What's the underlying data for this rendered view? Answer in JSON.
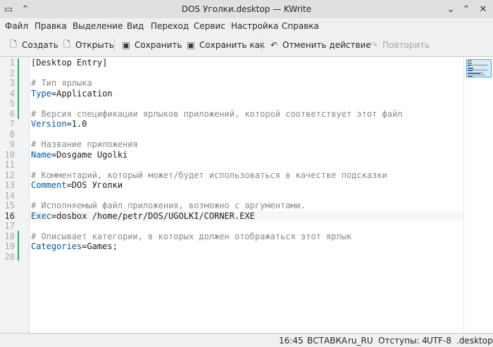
{
  "window": {
    "title": "DOS Уголки.desktop — KWrite"
  },
  "menu": [
    "Файл",
    "Правка",
    "Выделение",
    "Вид",
    "Переход",
    "Сервис",
    "Настройка",
    "Справка"
  ],
  "toolbar": {
    "new_label": "Создать",
    "open_label": "Открыть",
    "save_label": "Сохранить",
    "save_as_label": "Сохранить как",
    "undo_label": "Отменить действие",
    "redo_label": "Повторить"
  },
  "editor": {
    "current_line": 16,
    "lines": [
      [
        {
          "t": "[Desktop Entry]",
          "c": "plain"
        }
      ],
      [],
      [
        {
          "t": "# Тип ярлыка",
          "c": "comment"
        }
      ],
      [
        {
          "t": "Type",
          "c": "key"
        },
        {
          "t": "=Application",
          "c": "plain"
        }
      ],
      [],
      [
        {
          "t": "# Версия спецификации ярлыков приложений, которой соответствует этот файл",
          "c": "comment"
        }
      ],
      [
        {
          "t": "Version",
          "c": "key"
        },
        {
          "t": "=1.0",
          "c": "plain"
        }
      ],
      [],
      [
        {
          "t": "# Название приложения",
          "c": "comment"
        }
      ],
      [
        {
          "t": "Name",
          "c": "key"
        },
        {
          "t": "=Dosgame Ugolki",
          "c": "plain"
        }
      ],
      [],
      [
        {
          "t": "# Комментарий, который может/будет использоваться в качестве подсказки",
          "c": "comment"
        }
      ],
      [
        {
          "t": "Comment",
          "c": "key"
        },
        {
          "t": "=DOS Уголки",
          "c": "plain"
        }
      ],
      [],
      [
        {
          "t": "# Исполняемый файл приложения, возможно с аргументами.",
          "c": "comment"
        }
      ],
      [
        {
          "t": "Exec",
          "c": "key"
        },
        {
          "t": "=dosbox /home/petr/DOS/UGOLKI/CORNER.EXE",
          "c": "plain"
        }
      ],
      [],
      [
        {
          "t": "# Описывает категории, в которых должен отображаться этот ярлык",
          "c": "comment"
        }
      ],
      [
        {
          "t": "Categories",
          "c": "key"
        },
        {
          "t": "=Games;",
          "c": "plain"
        }
      ],
      []
    ]
  },
  "status": {
    "position": "16:45",
    "mode": "ВСТАВКА",
    "language": "ru_RU",
    "indent": "Отступы: 4",
    "encoding": "UTF-8",
    "filetype": ".desktop"
  },
  "colors": {
    "comment": "#898887",
    "key": "#0057ae",
    "modified_marker": "#3daee9",
    "saved_marker": "#27ae60",
    "accent": "#3daee9"
  }
}
